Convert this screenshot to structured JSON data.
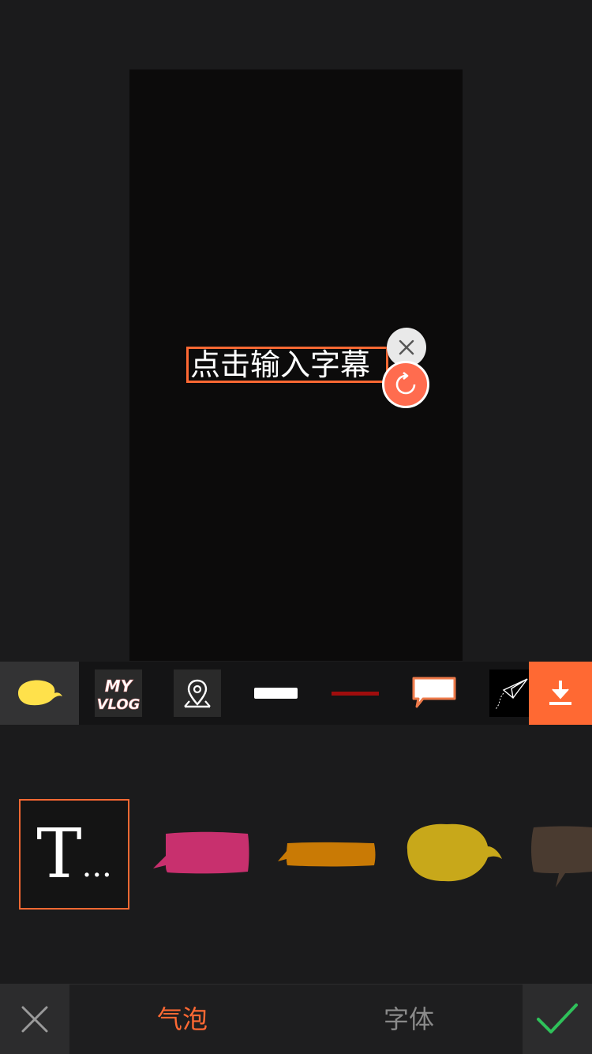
{
  "editor": {
    "caption_placeholder": "点击输入字幕"
  },
  "categories": [
    {
      "name": "yellow-bubble",
      "selected": true
    },
    {
      "name": "my-vlog",
      "text": "MY VLOG"
    },
    {
      "name": "location"
    },
    {
      "name": "white-bar"
    },
    {
      "name": "red-line"
    },
    {
      "name": "speech-box"
    },
    {
      "name": "paper-plane"
    }
  ],
  "styles": [
    {
      "name": "text-only",
      "label_t": "T",
      "label_dots": "...",
      "selected": true
    },
    {
      "name": "pink-bubble",
      "color": "#c8306e"
    },
    {
      "name": "orange-banner",
      "color": "#c97a05"
    },
    {
      "name": "yellow-bubble",
      "color": "#c8a81a"
    },
    {
      "name": "brown-bubble",
      "color": "#4a3b30"
    }
  ],
  "tabs": {
    "bubble": "气泡",
    "font": "字体"
  },
  "colors": {
    "accent": "#ff6933",
    "confirm": "#2fc15a"
  }
}
